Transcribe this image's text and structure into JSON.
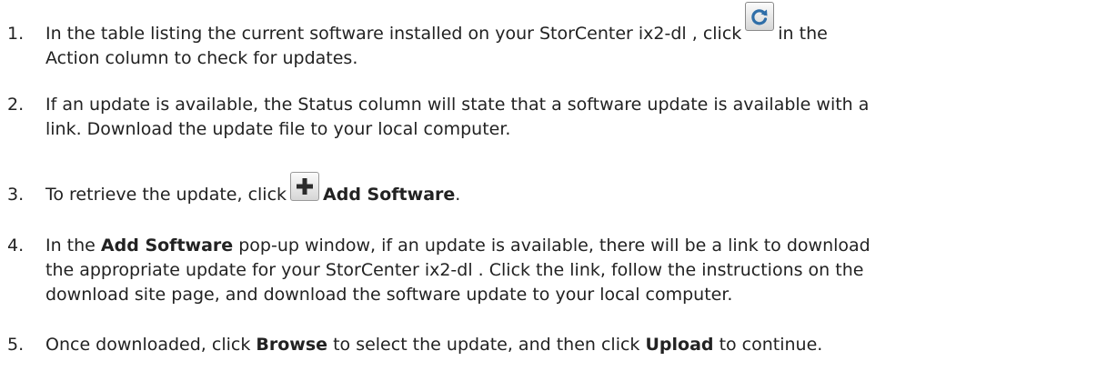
{
  "steps": [
    {
      "num": "1.",
      "line1_a": "In the table listing the current software installed on your StorCenter ix2-dl , click",
      "line1_b": "in the",
      "line2": "Action column to check for updates.",
      "icon": "refresh-icon"
    },
    {
      "num": "2.",
      "line1": "If an update is available, the Status column will state that a software update is available with a",
      "line2": "link. Download the update file to your local computer."
    },
    {
      "num": "3.",
      "text_a": "To retrieve the update, click",
      "bold": "Add Software",
      "text_b": ".",
      "icon": "add-icon"
    },
    {
      "num": "4.",
      "line1_a": "In the",
      "line1_bold": "Add Software",
      "line1_b": "pop-up window, if an update is available, there will be a link to download",
      "line2": "the appropriate update for your StorCenter ix2-dl . Click the link, follow the instructions on the",
      "line3": "download site page, and download the software update to your local computer."
    },
    {
      "num": "5.",
      "text_a": "Once downloaded, click",
      "bold1": "Browse",
      "text_b": "to select the update, and then click",
      "bold2": "Upload",
      "text_c": "to continue."
    }
  ]
}
